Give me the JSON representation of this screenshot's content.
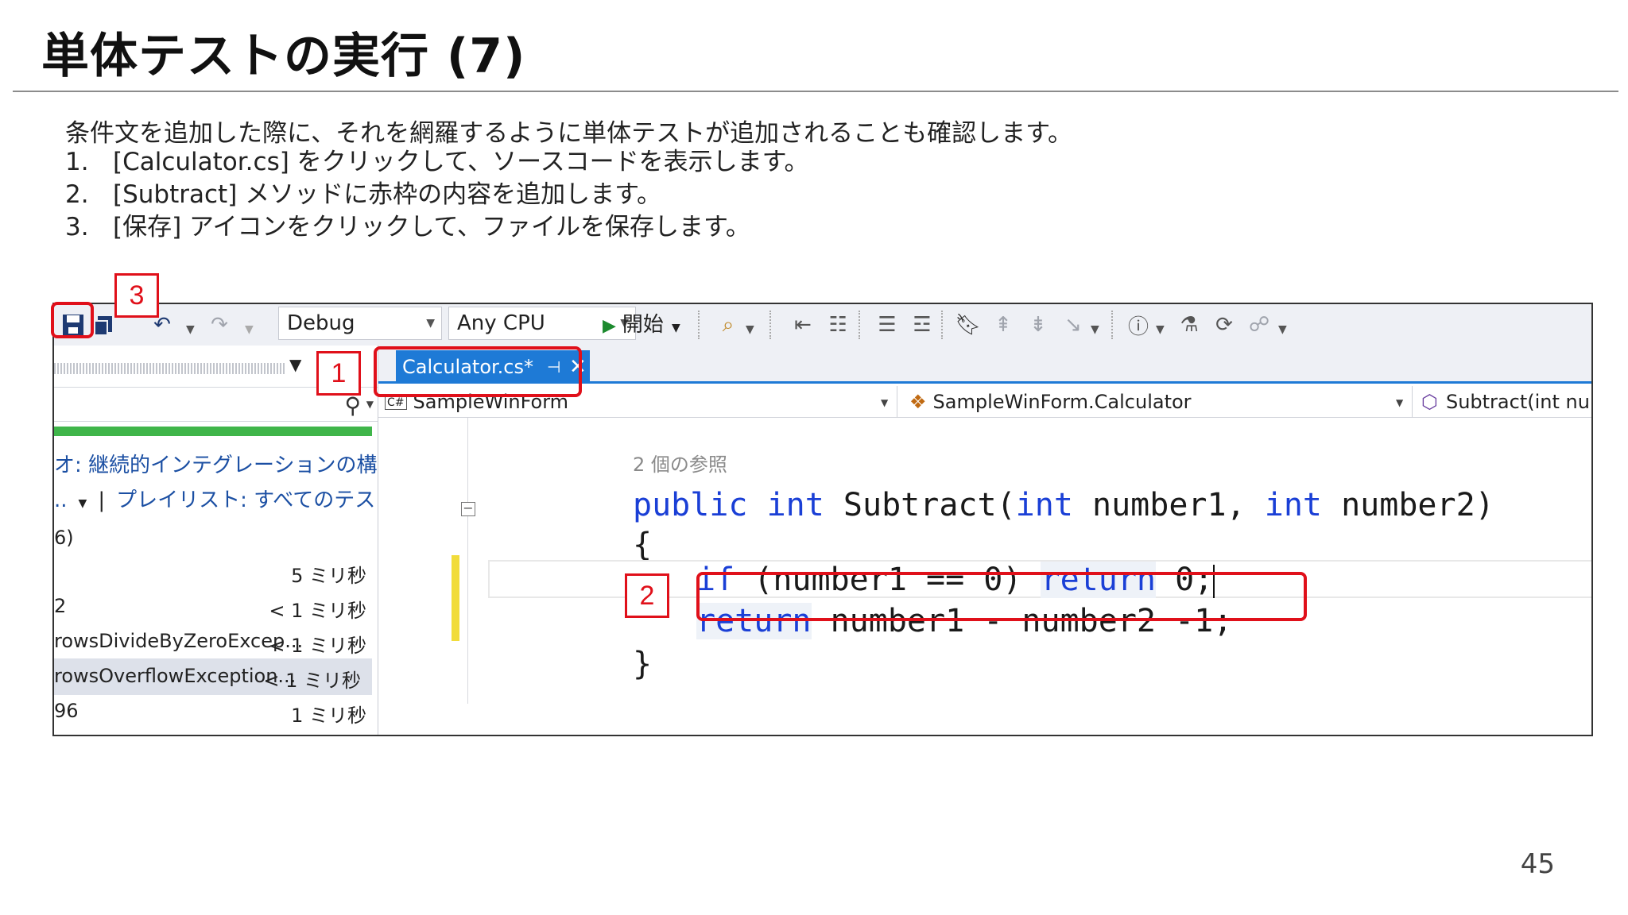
{
  "slide": {
    "title": "単体テストの実行 (7)",
    "intro": "条件文を追加した際に、それを網羅するように単体テストが追加されることも確認します。",
    "steps": [
      {
        "num": "1.",
        "text": "[Calculator.cs] をクリックして、ソースコードを表示します。"
      },
      {
        "num": "2.",
        "text": "[Subtract] メソッドに赤枠の内容を追加します。"
      },
      {
        "num": "3.",
        "text": "[保存] アイコンをクリックして、ファイルを保存します。"
      }
    ],
    "page_number": "45"
  },
  "callouts": {
    "one": "1",
    "two": "2",
    "three": "3"
  },
  "toolbar": {
    "config": "Debug",
    "platform": "Any CPU",
    "start_label": "開始"
  },
  "left_panel": {
    "header_text": "オ: 継続的インテグレーションの構成",
    "playlist_text": "プレイリスト: すべてのテスト",
    "row1_left": "6)",
    "rows": [
      {
        "left": "",
        "right": "5 ミリ秒"
      },
      {
        "left": "2",
        "right": "< 1 ミリ秒"
      },
      {
        "left": "rowsDivideByZeroExcep...",
        "right": "< 1 ミリ秒"
      },
      {
        "left": "rowsOverflowException...",
        "right": "< 1 ミリ秒"
      },
      {
        "left": "96",
        "right": "1 ミリ秒"
      }
    ]
  },
  "editor": {
    "tab_label": "Calculator.cs*",
    "nav_project": "SampleWinForm",
    "nav_class": "SampleWinForm.Calculator",
    "nav_member": "Subtract(int num",
    "refs": "2 個の参照",
    "code": {
      "kw_public": "public",
      "kw_int": "int",
      "method": " Subtract(",
      "kw_int2": "int",
      "param1": " number1, ",
      "kw_int3": "int",
      "param2": " number2)",
      "open_brace": "{",
      "kw_if": "if",
      "cond": " (number1 == 0) ",
      "kw_return": "return",
      "ret0": " 0;",
      "kw_return2": "return",
      "ret_expr": " number1 - number2 -1;",
      "close_brace": "}"
    }
  }
}
